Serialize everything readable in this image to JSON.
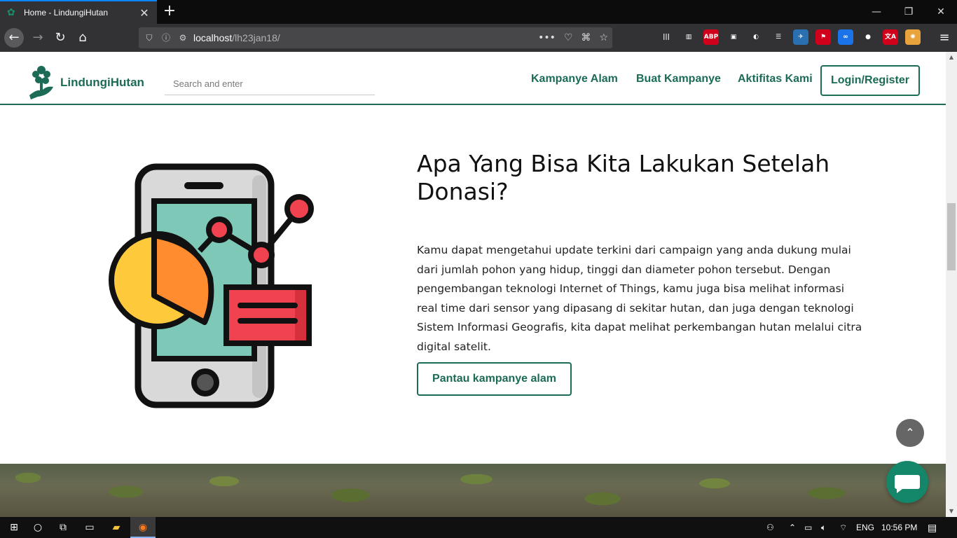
{
  "browser": {
    "tab_title": "Home - LindungiHutan",
    "tab_close": "✕",
    "new_tab": "+",
    "url_host": "localhost",
    "url_path": "/lh23jan18/",
    "url_more": "•••"
  },
  "extensions": [
    {
      "name": "library-icon",
      "color": "#323234",
      "label": "|||"
    },
    {
      "name": "reader-icon",
      "color": "#323234",
      "label": "▥"
    },
    {
      "name": "adblock-icon",
      "color": "#d0021b",
      "label": "ABP"
    },
    {
      "name": "container-icon",
      "color": "#323234",
      "label": "▣"
    },
    {
      "name": "sync-icon",
      "color": "#323234",
      "label": "◐"
    },
    {
      "name": "list-icon",
      "color": "#323234",
      "label": "☰"
    },
    {
      "name": "plane-icon",
      "color": "#2a6fb0",
      "label": "✈"
    },
    {
      "name": "flag-icon",
      "color": "#d0021b",
      "label": "⚑"
    },
    {
      "name": "infinity-icon",
      "color": "#1a73e8",
      "label": "∞"
    },
    {
      "name": "account-icon",
      "color": "#323234",
      "label": "●"
    },
    {
      "name": "translate-icon",
      "color": "#d0021b",
      "label": "文A"
    },
    {
      "name": "color-icon",
      "color": "#e8a33d",
      "label": "✺"
    }
  ],
  "site": {
    "logo_text": "LindungiHutan",
    "search_placeholder": "Search and enter",
    "menu": [
      "Kampanye Alam",
      "Buat Kampanye",
      "Aktifitas Kami"
    ],
    "login_label": "Login/Register"
  },
  "section": {
    "heading": "Apa Yang Bisa Kita Lakukan Setelah Donasi?",
    "body": "Kamu dapat mengetahui update terkini dari campaign yang anda dukung mulai dari jumlah pohon yang hidup, tinggi dan diameter pohon tersebut. Dengan pengembangan teknologi Internet of Things, kamu juga bisa melihat informasi real time dari sensor yang dipasang di sekitar hutan, dan juga dengan teknologi Sistem Informasi Geografis, kita dapat melihat perkembangan hutan melalui citra digital satelit.",
    "cta_label": "Pantau kampanye alam"
  },
  "colors": {
    "brand_green": "#1b6b57",
    "chat_green": "#14866a"
  },
  "taskbar": {
    "language": "ENG",
    "time": "10:56 PM"
  }
}
